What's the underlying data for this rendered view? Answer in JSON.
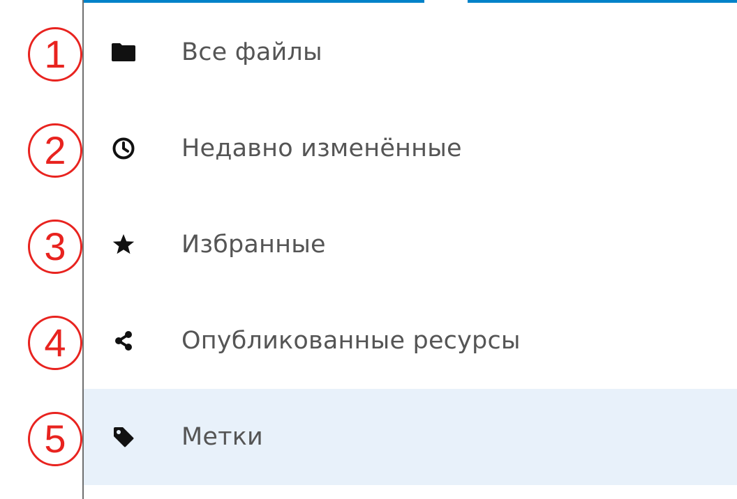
{
  "colors": {
    "accent": "#0082c9",
    "active_bg": "#e8f1fa",
    "marker": "#e8231f",
    "text": "#555555"
  },
  "nav": {
    "items": [
      {
        "label": "Все файлы",
        "icon": "folder-icon",
        "marker": "1",
        "active": false
      },
      {
        "label": "Недавно изменённые",
        "icon": "clock-icon",
        "marker": "2",
        "active": false
      },
      {
        "label": "Избранные",
        "icon": "star-icon",
        "marker": "3",
        "active": false
      },
      {
        "label": "Опубликованные ресурсы",
        "icon": "share-icon",
        "marker": "4",
        "active": false
      },
      {
        "label": "Метки",
        "icon": "tag-icon",
        "marker": "5",
        "active": true
      }
    ]
  }
}
